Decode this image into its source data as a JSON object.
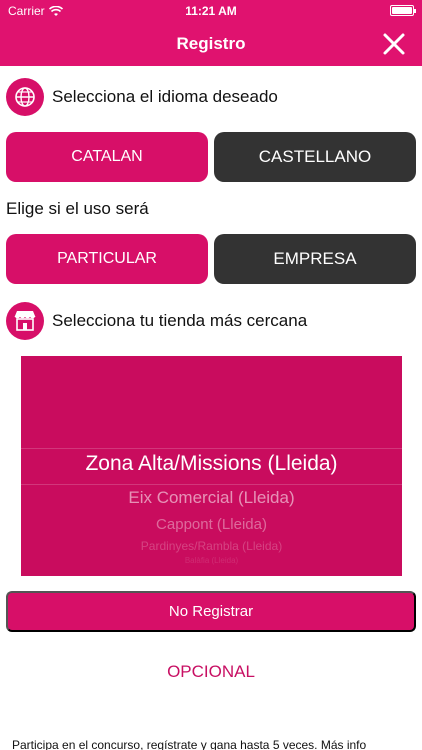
{
  "status_bar": {
    "carrier": "Carrier",
    "time": "11:21 AM"
  },
  "nav": {
    "title": "Registro"
  },
  "language": {
    "prompt": "Selecciona el idioma deseado",
    "options": [
      "CATALAN",
      "CASTELLANO"
    ]
  },
  "usage": {
    "prompt": "Elige si el uso será",
    "options": [
      "PARTICULAR",
      "EMPRESA"
    ]
  },
  "store": {
    "prompt": "Selecciona tu tienda más cercana",
    "picker_options": [
      "Zona Alta/Missions (Lleida)",
      "Eix Comercial (Lleida)",
      "Cappont (Lleida)",
      "Pardinyes/Rambla (Lleida)",
      "Balàfia (Lleida)"
    ],
    "selected": "Zona Alta/Missions (Lleida)"
  },
  "actions": {
    "no_register": "No Registrar",
    "optional": "OPCIONAL"
  },
  "footer": {
    "text": "Participa en el concurso, regístrate y gana hasta 5 veces. Más info"
  },
  "colors": {
    "accent": "#e0126f",
    "button_pink": "#d70f68",
    "button_dark": "#333333"
  },
  "icons": {
    "close": "close-icon",
    "globe": "globe-icon",
    "store": "store-icon",
    "wifi": "wifi-icon",
    "battery": "battery-icon"
  }
}
